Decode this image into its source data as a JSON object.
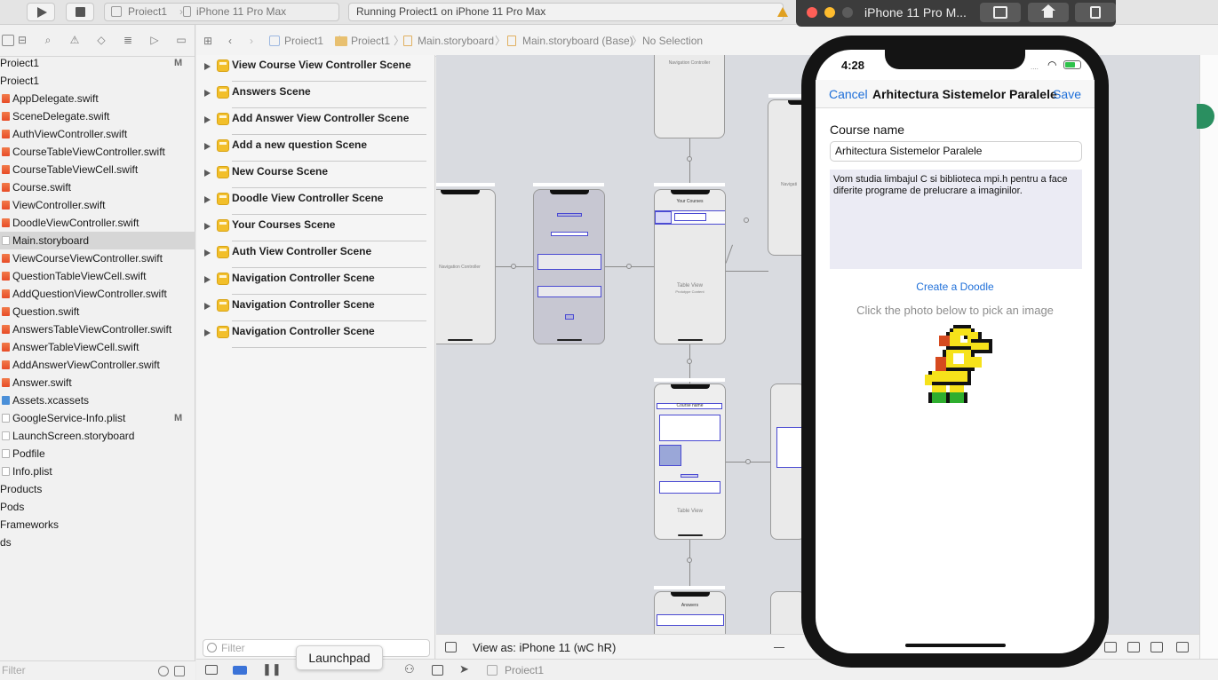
{
  "toolbar": {
    "scheme_target": "Proiect1",
    "scheme_device": "iPhone 11 Pro Max",
    "activity_status": "Running Proiect1 on iPhone 11 Pro Max"
  },
  "navigator": {
    "files": [
      {
        "name": "Proiect1",
        "badge": "M",
        "kind": "project"
      },
      {
        "name": "Proiect1",
        "badge": "",
        "kind": "group"
      },
      {
        "name": "AppDelegate.swift",
        "badge": "",
        "kind": "swift"
      },
      {
        "name": "SceneDelegate.swift",
        "badge": "",
        "kind": "swift"
      },
      {
        "name": "AuthViewController.swift",
        "badge": "",
        "kind": "swift"
      },
      {
        "name": "CourseTableViewController.swift",
        "badge": "",
        "kind": "swift"
      },
      {
        "name": "CourseTableViewCell.swift",
        "badge": "",
        "kind": "swift"
      },
      {
        "name": "Course.swift",
        "badge": "",
        "kind": "swift"
      },
      {
        "name": "ViewController.swift",
        "badge": "",
        "kind": "swift"
      },
      {
        "name": "DoodleViewController.swift",
        "badge": "",
        "kind": "swift"
      },
      {
        "name": "Main.storyboard",
        "badge": "",
        "kind": "storyboard",
        "selected": true
      },
      {
        "name": "ViewCourseViewController.swift",
        "badge": "",
        "kind": "swift"
      },
      {
        "name": "QuestionTableViewCell.swift",
        "badge": "",
        "kind": "swift"
      },
      {
        "name": "AddQuestionViewController.swift",
        "badge": "",
        "kind": "swift"
      },
      {
        "name": "Question.swift",
        "badge": "",
        "kind": "swift"
      },
      {
        "name": "AnswersTableViewController.swift",
        "badge": "",
        "kind": "swift"
      },
      {
        "name": "AnswerTableViewCell.swift",
        "badge": "",
        "kind": "swift"
      },
      {
        "name": "AddAnswerViewController.swift",
        "badge": "",
        "kind": "swift"
      },
      {
        "name": "Answer.swift",
        "badge": "",
        "kind": "swift"
      },
      {
        "name": "Assets.xcassets",
        "badge": "",
        "kind": "assets"
      },
      {
        "name": "GoogleService-Info.plist",
        "badge": "M",
        "kind": "plist"
      },
      {
        "name": "LaunchScreen.storyboard",
        "badge": "",
        "kind": "storyboard"
      },
      {
        "name": "Podfile",
        "badge": "",
        "kind": "plist"
      },
      {
        "name": "Info.plist",
        "badge": "",
        "kind": "plist"
      },
      {
        "name": "Products",
        "badge": "",
        "kind": "group"
      },
      {
        "name": "Pods",
        "badge": "",
        "kind": "group"
      },
      {
        "name": "Frameworks",
        "badge": "",
        "kind": "group"
      },
      {
        "name": "ds",
        "badge": "",
        "kind": "group"
      }
    ],
    "filter_placeholder": "Filter"
  },
  "jumpbar": {
    "crumbs": [
      "Proiect1",
      "Proiect1",
      "Main.storyboard",
      "Main.storyboard (Base)",
      "No Selection"
    ]
  },
  "outline": {
    "scenes": [
      "View Course View Controller Scene",
      "Answers Scene",
      "Add Answer View Controller Scene",
      "Add a new question Scene",
      "New Course Scene",
      "Doodle View Controller Scene",
      "Your Courses Scene",
      "Auth View Controller Scene",
      "Navigation Controller Scene",
      "Navigation Controller Scene",
      "Navigation Controller Scene"
    ],
    "filter_placeholder": "Filter"
  },
  "canvas": {
    "nav_controller_label": "Navigation Controller",
    "table_view_label": "Table View",
    "prototype_content_label": "Prototype Content",
    "your_courses_title": "Your Courses",
    "course_name_label": "Course name",
    "answers_title": "Answers",
    "navigation_label_partial": "Navigati"
  },
  "bottombar": {
    "view_as": "View as: iPhone 11 (wC hR)"
  },
  "debugbar": {
    "target": "Proiect1",
    "launchpad_tooltip": "Launchpad"
  },
  "simulator": {
    "window_title": "iPhone 11 Pro M...",
    "status_time": "4:28",
    "nav_cancel": "Cancel",
    "nav_title": "Arhitectura Sistemelor Paralele",
    "nav_save": "Save",
    "course_name_label": "Course name",
    "course_name_value": "Arhitectura Sistemelor Paralele",
    "description": "Vom studia limbajul C si biblioteca mpi.h pentru a face diferite programe de prelucrare a imaginilor.",
    "create_doodle": "Create a Doodle",
    "photo_hint": "Click the photo below to pick an image"
  },
  "colors": {
    "ios_tint": "#1e6fd9",
    "storyboard_selection": "#4a4ad2",
    "scene_icon": "#f2bf2a"
  }
}
